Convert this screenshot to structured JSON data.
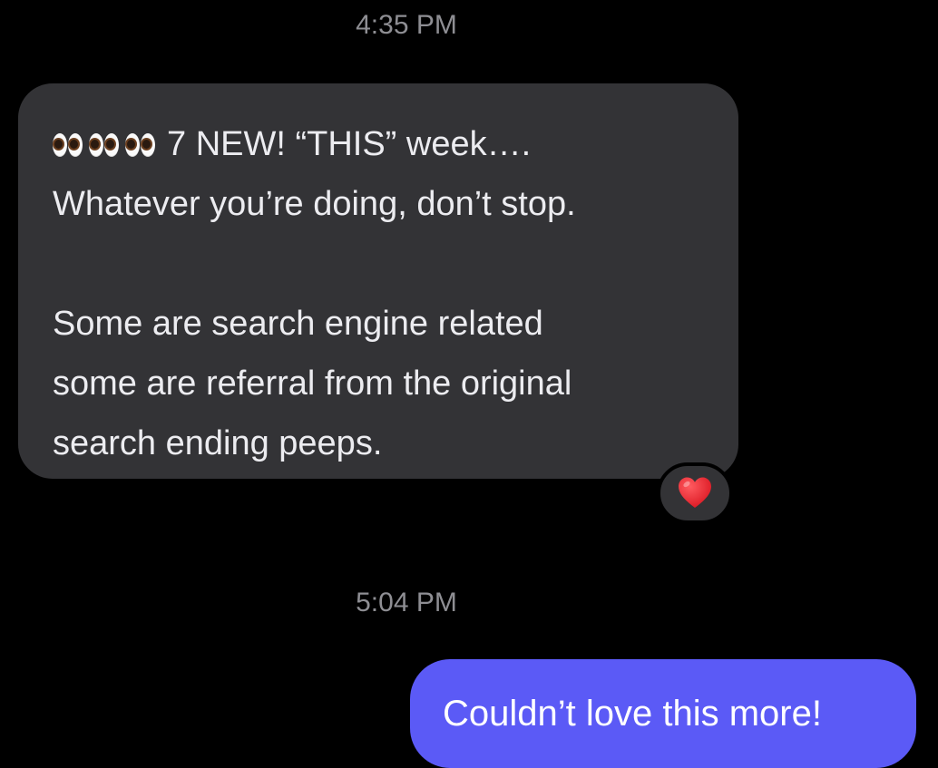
{
  "timestamps": [
    "4:35 PM",
    "5:04 PM"
  ],
  "incoming": {
    "emoji": "eyes-emoji",
    "line1_text": "7 NEW!  “THIS” week….",
    "line2": "Whatever you’re doing, don’t stop.",
    "line3": "Some are search engine related",
    "line4": "some are referral from the original",
    "line5": "search ending peeps.",
    "reaction": "heart-icon"
  },
  "outgoing": {
    "text": "Couldn’t love this more!"
  },
  "colors": {
    "background": "#000000",
    "incoming_bubble": "#333336",
    "outgoing_bubble": "#5b5af6",
    "timestamp": "#8e8e93",
    "heart": "#e8232e"
  }
}
